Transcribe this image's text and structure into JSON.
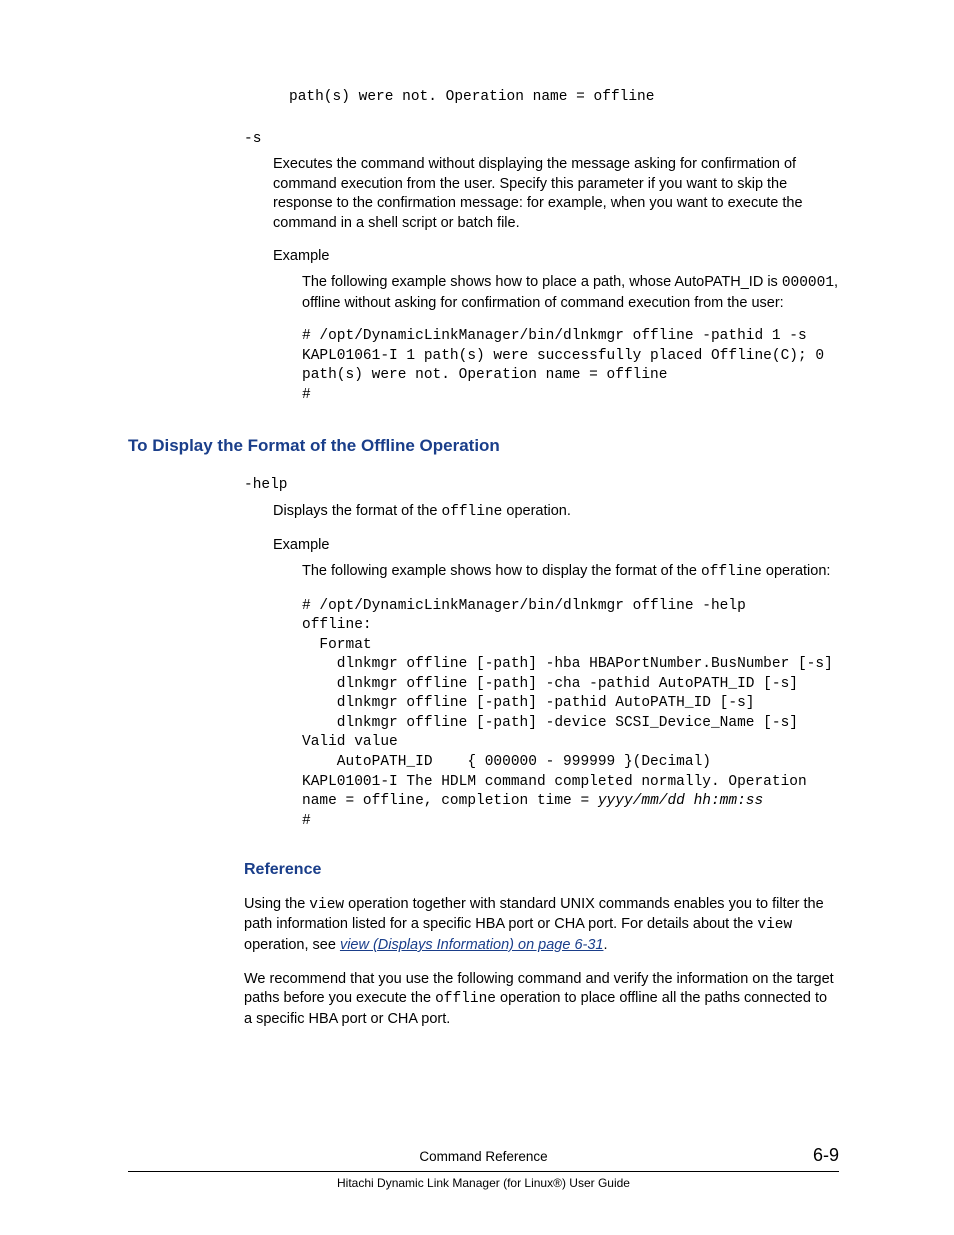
{
  "top_pre": "path(s) were not. Operation name = offline",
  "s_param": {
    "name": "-s",
    "desc": "Executes the command without displaying the message asking for confirmation of command execution from the user. Specify this parameter if you want to skip the response to the confirmation message: for example, when you want to execute the command in a shell script or batch file.",
    "example_label": "Example",
    "example_desc_1": "The following example shows how to place a path, whose AutoPATH_ID is ",
    "example_desc_code": "000001",
    "example_desc_2": ", offline without asking for confirmation of command execution from the user:",
    "example_pre": "# /opt/DynamicLinkManager/bin/dlnkmgr offline -pathid 1 -s\nKAPL01061-I 1 path(s) were successfully placed Offline(C); 0 \npath(s) were not. Operation name = offline\n#"
  },
  "section2": {
    "heading": "To Display the Format of the Offline Operation",
    "help_param": {
      "name": "-help",
      "desc_1": "Displays the format of the ",
      "desc_code": "offline",
      "desc_2": " operation.",
      "example_label": "Example",
      "example_desc_1": "The following example shows how to display the format of the ",
      "example_desc_code": "offline",
      "example_desc_2": " operation:",
      "example_pre_1": "# /opt/DynamicLinkManager/bin/dlnkmgr offline -help\noffline:\n  Format\n    dlnkmgr offline [-path] -hba HBAPortNumber.BusNumber [-s]\n    dlnkmgr offline [-path] -cha -pathid AutoPATH_ID [-s]\n    dlnkmgr offline [-path] -pathid AutoPATH_ID [-s]\n    dlnkmgr offline [-path] -device SCSI_Device_Name [-s]\nValid value\n    AutoPATH_ID    { 000000 - 999999 }(Decimal)\nKAPL01001-I The HDLM command completed normally. Operation \nname = offline, completion time = ",
      "example_pre_time": "yyyy/mm/dd hh:mm:ss",
      "example_pre_2": "\n#"
    }
  },
  "reference": {
    "heading": "Reference",
    "p1_1": "Using the ",
    "p1_code1": "view",
    "p1_2": " operation together with standard UNIX commands enables you to filter the path information listed for a specific HBA port or CHA port. For details about the ",
    "p1_code2": "view",
    "p1_3": " operation, see ",
    "p1_link": "view (Displays Information) on page 6-31",
    "p1_4": ".",
    "p2_1": "We recommend that you use the following command and verify the information on the target paths before you execute the ",
    "p2_code": "offline",
    "p2_2": " operation to place offline all the paths connected to a specific HBA port or CHA port."
  },
  "footer": {
    "section": "Command Reference",
    "page": "6-9",
    "book": "Hitachi Dynamic Link Manager (for Linux®) User Guide"
  }
}
